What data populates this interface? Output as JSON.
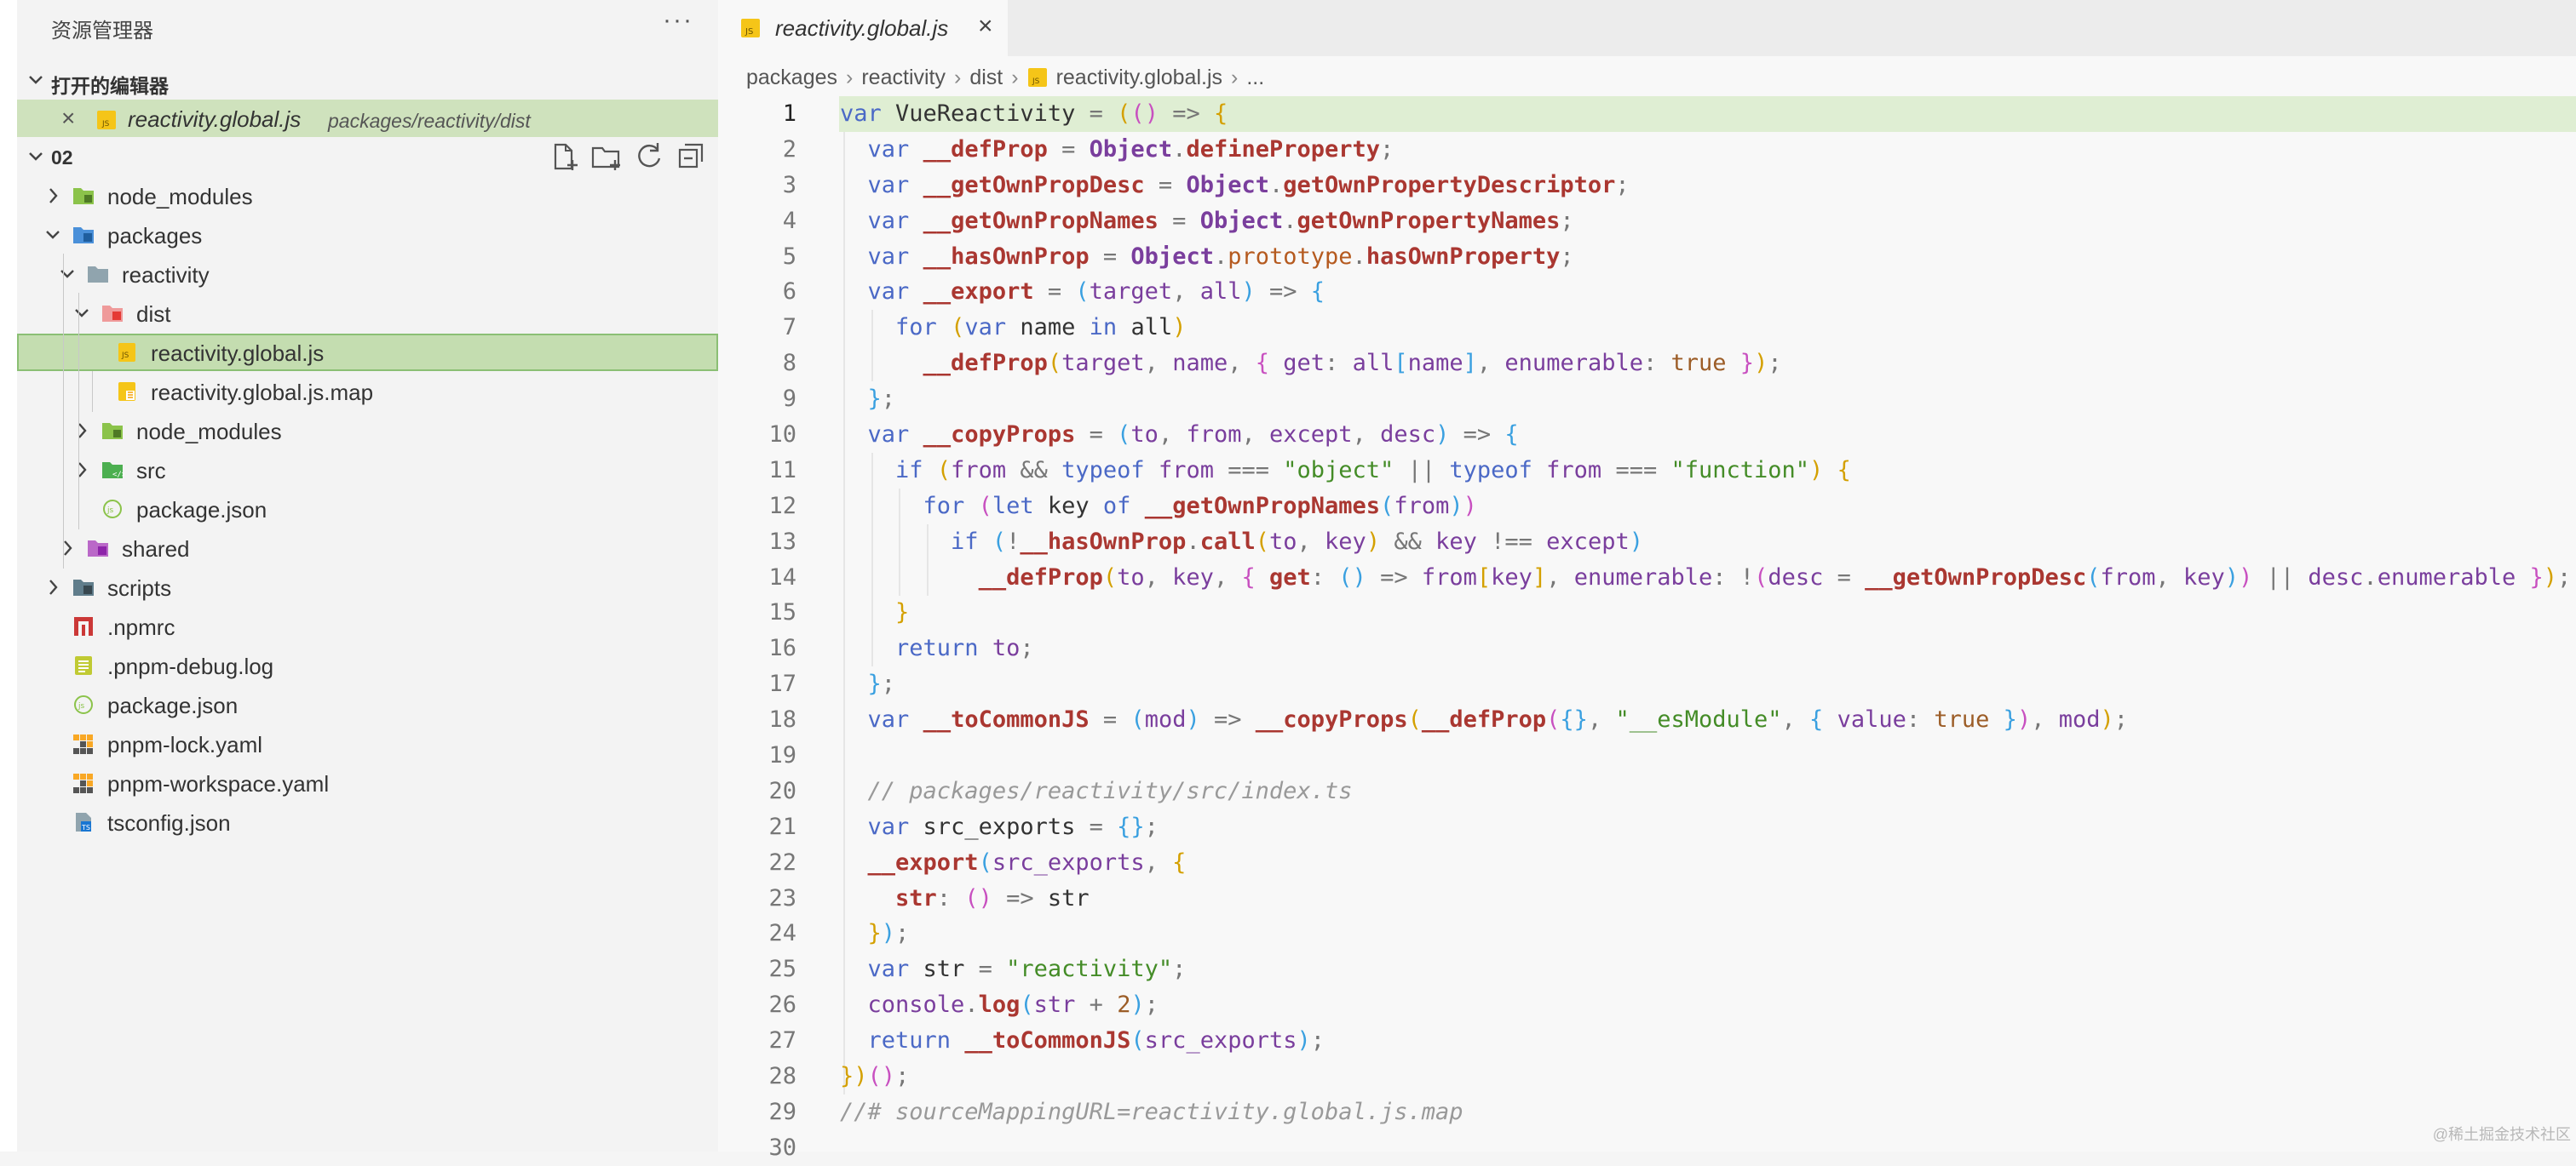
{
  "explorer": {
    "title": "资源管理器",
    "more": "···",
    "open_editors_label": "打开的编辑器",
    "open_editor": {
      "close": "×",
      "name": "reactivity.global.js",
      "path": "packages/reactivity/dist"
    },
    "workspace_label": "02",
    "tree": [
      {
        "label": "node_modules",
        "depth": 0,
        "kind": "folder-node",
        "chevron": "right"
      },
      {
        "label": "packages",
        "depth": 0,
        "kind": "folder-packages",
        "chevron": "down"
      },
      {
        "label": "reactivity",
        "depth": 1,
        "kind": "folder-plain",
        "chevron": "down"
      },
      {
        "label": "dist",
        "depth": 2,
        "kind": "folder-dist",
        "chevron": "down"
      },
      {
        "label": "reactivity.global.js",
        "depth": 3,
        "kind": "file-js",
        "chevron": "none",
        "selected": true
      },
      {
        "label": "reactivity.global.js.map",
        "depth": 3,
        "kind": "file-map",
        "chevron": "none"
      },
      {
        "label": "node_modules",
        "depth": 2,
        "kind": "folder-node",
        "chevron": "right"
      },
      {
        "label": "src",
        "depth": 2,
        "kind": "folder-src",
        "chevron": "right"
      },
      {
        "label": "package.json",
        "depth": 2,
        "kind": "file-json",
        "chevron": "none"
      },
      {
        "label": "shared",
        "depth": 1,
        "kind": "folder-shared",
        "chevron": "right"
      },
      {
        "label": "scripts",
        "depth": 0,
        "kind": "folder-scripts",
        "chevron": "right"
      },
      {
        "label": ".npmrc",
        "depth": 0,
        "kind": "file-npm",
        "chevron": "none"
      },
      {
        "label": ".pnpm-debug.log",
        "depth": 0,
        "kind": "file-log",
        "chevron": "none"
      },
      {
        "label": "package.json",
        "depth": 0,
        "kind": "file-json",
        "chevron": "none"
      },
      {
        "label": "pnpm-lock.yaml",
        "depth": 0,
        "kind": "file-pnpm",
        "chevron": "none"
      },
      {
        "label": "pnpm-workspace.yaml",
        "depth": 0,
        "kind": "file-pnpm",
        "chevron": "none"
      },
      {
        "label": "tsconfig.json",
        "depth": 0,
        "kind": "file-ts",
        "chevron": "none"
      }
    ]
  },
  "editor": {
    "tab": {
      "name": "reactivity.global.js",
      "close": "×"
    },
    "breadcrumb": [
      "packages",
      "reactivity",
      "dist",
      "reactivity.global.js",
      "..."
    ],
    "active_line": 1,
    "lines": [
      [
        [
          "kw",
          "var"
        ],
        [
          "id",
          " VueReactivity "
        ],
        [
          "op",
          "="
        ],
        [
          "id",
          " "
        ],
        [
          "b1",
          "("
        ],
        [
          "b2",
          "("
        ],
        [
          "b2",
          ")"
        ],
        [
          "op",
          " =>"
        ],
        [
          "id",
          " "
        ],
        [
          "b1",
          "{"
        ]
      ],
      [
        [
          "id",
          "  "
        ],
        [
          "kw",
          "var"
        ],
        [
          "id",
          " "
        ],
        [
          "fn",
          "__defProp"
        ],
        [
          "op",
          " = "
        ],
        [
          "obj",
          "Object"
        ],
        [
          "pun",
          "."
        ],
        [
          "fn",
          "defineProperty"
        ],
        [
          "pun",
          ";"
        ]
      ],
      [
        [
          "id",
          "  "
        ],
        [
          "kw",
          "var"
        ],
        [
          "id",
          " "
        ],
        [
          "fn",
          "__getOwnPropDesc"
        ],
        [
          "op",
          " = "
        ],
        [
          "obj",
          "Object"
        ],
        [
          "pun",
          "."
        ],
        [
          "fn",
          "getOwnPropertyDescriptor"
        ],
        [
          "pun",
          ";"
        ]
      ],
      [
        [
          "id",
          "  "
        ],
        [
          "kw",
          "var"
        ],
        [
          "id",
          " "
        ],
        [
          "fn",
          "__getOwnPropNames"
        ],
        [
          "op",
          " = "
        ],
        [
          "obj",
          "Object"
        ],
        [
          "pun",
          "."
        ],
        [
          "fn",
          "getOwnPropertyNames"
        ],
        [
          "pun",
          ";"
        ]
      ],
      [
        [
          "id",
          "  "
        ],
        [
          "kw",
          "var"
        ],
        [
          "id",
          " "
        ],
        [
          "fn",
          "__hasOwnProp"
        ],
        [
          "op",
          " = "
        ],
        [
          "obj",
          "Object"
        ],
        [
          "pun",
          "."
        ],
        [
          "prop",
          "prototype"
        ],
        [
          "pun",
          "."
        ],
        [
          "fn",
          "hasOwnProperty"
        ],
        [
          "pun",
          ";"
        ]
      ],
      [
        [
          "id",
          "  "
        ],
        [
          "kw",
          "var"
        ],
        [
          "id",
          " "
        ],
        [
          "fn",
          "__export"
        ],
        [
          "op",
          " = "
        ],
        [
          "b3",
          "("
        ],
        [
          "var",
          "target"
        ],
        [
          "pun",
          ", "
        ],
        [
          "var",
          "all"
        ],
        [
          "b3",
          ")"
        ],
        [
          "op",
          " => "
        ],
        [
          "b3",
          "{"
        ]
      ],
      [
        [
          "id",
          "    "
        ],
        [
          "kw",
          "for"
        ],
        [
          "id",
          " "
        ],
        [
          "b1",
          "("
        ],
        [
          "kw",
          "var"
        ],
        [
          "id",
          " name "
        ],
        [
          "kw",
          "in"
        ],
        [
          "id",
          " all"
        ],
        [
          "b1",
          ")"
        ]
      ],
      [
        [
          "id",
          "      "
        ],
        [
          "fn",
          "__defProp"
        ],
        [
          "b1",
          "("
        ],
        [
          "var",
          "target"
        ],
        [
          "pun",
          ", "
        ],
        [
          "var",
          "name"
        ],
        [
          "pun",
          ", "
        ],
        [
          "b2",
          "{"
        ],
        [
          "id",
          " "
        ],
        [
          "var",
          "get"
        ],
        [
          "pun",
          ": "
        ],
        [
          "var",
          "all"
        ],
        [
          "b3",
          "["
        ],
        [
          "var",
          "name"
        ],
        [
          "b3",
          "]"
        ],
        [
          "pun",
          ", "
        ],
        [
          "var",
          "enumerable"
        ],
        [
          "pun",
          ": "
        ],
        [
          "num",
          "true"
        ],
        [
          "id",
          " "
        ],
        [
          "b2",
          "}"
        ],
        [
          "b1",
          ")"
        ],
        [
          "pun",
          ";"
        ]
      ],
      [
        [
          "id",
          "  "
        ],
        [
          "b3",
          "}"
        ],
        [
          "pun",
          ";"
        ]
      ],
      [
        [
          "id",
          "  "
        ],
        [
          "kw",
          "var"
        ],
        [
          "id",
          " "
        ],
        [
          "fn",
          "__copyProps"
        ],
        [
          "op",
          " = "
        ],
        [
          "b3",
          "("
        ],
        [
          "var",
          "to"
        ],
        [
          "pun",
          ", "
        ],
        [
          "var",
          "from"
        ],
        [
          "pun",
          ", "
        ],
        [
          "var",
          "except"
        ],
        [
          "pun",
          ", "
        ],
        [
          "var",
          "desc"
        ],
        [
          "b3",
          ")"
        ],
        [
          "op",
          " => "
        ],
        [
          "b3",
          "{"
        ]
      ],
      [
        [
          "id",
          "    "
        ],
        [
          "kw",
          "if"
        ],
        [
          "id",
          " "
        ],
        [
          "b1",
          "("
        ],
        [
          "var",
          "from"
        ],
        [
          "op",
          " && "
        ],
        [
          "kw",
          "typeof"
        ],
        [
          "id",
          " "
        ],
        [
          "var",
          "from"
        ],
        [
          "op",
          " === "
        ],
        [
          "str",
          "\"object\""
        ],
        [
          "op",
          " || "
        ],
        [
          "kw",
          "typeof"
        ],
        [
          "id",
          " "
        ],
        [
          "var",
          "from"
        ],
        [
          "op",
          " === "
        ],
        [
          "str",
          "\"function\""
        ],
        [
          "b1",
          ")"
        ],
        [
          "id",
          " "
        ],
        [
          "b1",
          "{"
        ]
      ],
      [
        [
          "id",
          "      "
        ],
        [
          "kw",
          "for"
        ],
        [
          "id",
          " "
        ],
        [
          "b2",
          "("
        ],
        [
          "kw",
          "let"
        ],
        [
          "id",
          " key "
        ],
        [
          "kw",
          "of"
        ],
        [
          "id",
          " "
        ],
        [
          "fn",
          "__getOwnPropNames"
        ],
        [
          "b3",
          "("
        ],
        [
          "var",
          "from"
        ],
        [
          "b3",
          ")"
        ],
        [
          "b2",
          ")"
        ]
      ],
      [
        [
          "id",
          "        "
        ],
        [
          "kw",
          "if"
        ],
        [
          "id",
          " "
        ],
        [
          "b3",
          "("
        ],
        [
          "op",
          "!"
        ],
        [
          "fn",
          "__hasOwnProp"
        ],
        [
          "pun",
          "."
        ],
        [
          "fn",
          "call"
        ],
        [
          "b1",
          "("
        ],
        [
          "var",
          "to"
        ],
        [
          "pun",
          ", "
        ],
        [
          "var",
          "key"
        ],
        [
          "b1",
          ")"
        ],
        [
          "op",
          " && "
        ],
        [
          "var",
          "key"
        ],
        [
          "op",
          " !== "
        ],
        [
          "var",
          "except"
        ],
        [
          "b3",
          ")"
        ]
      ],
      [
        [
          "id",
          "          "
        ],
        [
          "fn",
          "__defProp"
        ],
        [
          "b1",
          "("
        ],
        [
          "var",
          "to"
        ],
        [
          "pun",
          ", "
        ],
        [
          "var",
          "key"
        ],
        [
          "pun",
          ", "
        ],
        [
          "b2",
          "{"
        ],
        [
          "id",
          " "
        ],
        [
          "fn",
          "get"
        ],
        [
          "pun",
          ": "
        ],
        [
          "b3",
          "("
        ],
        [
          "b3",
          ")"
        ],
        [
          "op",
          " => "
        ],
        [
          "var",
          "from"
        ],
        [
          "b1",
          "["
        ],
        [
          "var",
          "key"
        ],
        [
          "b1",
          "]"
        ],
        [
          "pun",
          ", "
        ],
        [
          "var",
          "enumerable"
        ],
        [
          "pun",
          ": "
        ],
        [
          "op",
          "!"
        ],
        [
          "b2",
          "("
        ],
        [
          "var",
          "desc"
        ],
        [
          "op",
          " = "
        ],
        [
          "fn",
          "__getOwnPropDesc"
        ],
        [
          "b3",
          "("
        ],
        [
          "var",
          "from"
        ],
        [
          "pun",
          ", "
        ],
        [
          "var",
          "key"
        ],
        [
          "b3",
          ")"
        ],
        [
          "b2",
          ")"
        ],
        [
          "op",
          " || "
        ],
        [
          "var",
          "desc"
        ],
        [
          "pun",
          "."
        ],
        [
          "var",
          "enumerable"
        ],
        [
          "id",
          " "
        ],
        [
          "b2",
          "}"
        ],
        [
          "b1",
          ")"
        ],
        [
          "pun",
          ";"
        ]
      ],
      [
        [
          "id",
          "    "
        ],
        [
          "b1",
          "}"
        ]
      ],
      [
        [
          "id",
          "    "
        ],
        [
          "kw",
          "return"
        ],
        [
          "id",
          " "
        ],
        [
          "var",
          "to"
        ],
        [
          "pun",
          ";"
        ]
      ],
      [
        [
          "id",
          "  "
        ],
        [
          "b3",
          "}"
        ],
        [
          "pun",
          ";"
        ]
      ],
      [
        [
          "id",
          "  "
        ],
        [
          "kw",
          "var"
        ],
        [
          "id",
          " "
        ],
        [
          "fn",
          "__toCommonJS"
        ],
        [
          "op",
          " = "
        ],
        [
          "b3",
          "("
        ],
        [
          "var",
          "mod"
        ],
        [
          "b3",
          ")"
        ],
        [
          "op",
          " => "
        ],
        [
          "fn",
          "__copyProps"
        ],
        [
          "b1",
          "("
        ],
        [
          "fn",
          "__defProp"
        ],
        [
          "b2",
          "("
        ],
        [
          "b3",
          "{}"
        ],
        [
          "pun",
          ", "
        ],
        [
          "str",
          "\"__esModule\""
        ],
        [
          "pun",
          ", "
        ],
        [
          "b3",
          "{"
        ],
        [
          "id",
          " "
        ],
        [
          "var",
          "value"
        ],
        [
          "pun",
          ": "
        ],
        [
          "num",
          "true"
        ],
        [
          "id",
          " "
        ],
        [
          "b3",
          "}"
        ],
        [
          "b2",
          ")"
        ],
        [
          "pun",
          ", "
        ],
        [
          "var",
          "mod"
        ],
        [
          "b1",
          ")"
        ],
        [
          "pun",
          ";"
        ]
      ],
      [],
      [
        [
          "id",
          "  "
        ],
        [
          "cm",
          "// packages/reactivity/src/index.ts"
        ]
      ],
      [
        [
          "id",
          "  "
        ],
        [
          "kw",
          "var"
        ],
        [
          "id",
          " src_exports "
        ],
        [
          "op",
          "= "
        ],
        [
          "b3",
          "{}"
        ],
        [
          "pun",
          ";"
        ]
      ],
      [
        [
          "id",
          "  "
        ],
        [
          "fn",
          "__export"
        ],
        [
          "b3",
          "("
        ],
        [
          "var",
          "src_exports"
        ],
        [
          "pun",
          ", "
        ],
        [
          "b1",
          "{"
        ]
      ],
      [
        [
          "id",
          "    "
        ],
        [
          "fn",
          "str"
        ],
        [
          "pun",
          ": "
        ],
        [
          "b2",
          "("
        ],
        [
          "b2",
          ")"
        ],
        [
          "op",
          " => "
        ],
        [
          "id",
          "str"
        ]
      ],
      [
        [
          "id",
          "  "
        ],
        [
          "b1",
          "}"
        ],
        [
          "b3",
          ")"
        ],
        [
          "pun",
          ";"
        ]
      ],
      [
        [
          "id",
          "  "
        ],
        [
          "kw",
          "var"
        ],
        [
          "id",
          " str "
        ],
        [
          "op",
          "= "
        ],
        [
          "str",
          "\"reactivity\""
        ],
        [
          "pun",
          ";"
        ]
      ],
      [
        [
          "id",
          "  "
        ],
        [
          "var",
          "console"
        ],
        [
          "pun",
          "."
        ],
        [
          "fn",
          "log"
        ],
        [
          "b3",
          "("
        ],
        [
          "var",
          "str"
        ],
        [
          "op",
          " + "
        ],
        [
          "num",
          "2"
        ],
        [
          "b3",
          ")"
        ],
        [
          "pun",
          ";"
        ]
      ],
      [
        [
          "id",
          "  "
        ],
        [
          "kw",
          "return"
        ],
        [
          "id",
          " "
        ],
        [
          "fn",
          "__toCommonJS"
        ],
        [
          "b3",
          "("
        ],
        [
          "var",
          "src_exports"
        ],
        [
          "b3",
          ")"
        ],
        [
          "pun",
          ";"
        ]
      ],
      [
        [
          "b1",
          "}"
        ],
        [
          "b1",
          ")"
        ],
        [
          "b2",
          "("
        ],
        [
          "b2",
          ")"
        ],
        [
          "pun",
          ";"
        ]
      ],
      [
        [
          "cm",
          "//# sourceMappingURL=reactivity.global.js.map"
        ]
      ],
      []
    ]
  },
  "watermark": "@稀土掘金技术社区"
}
